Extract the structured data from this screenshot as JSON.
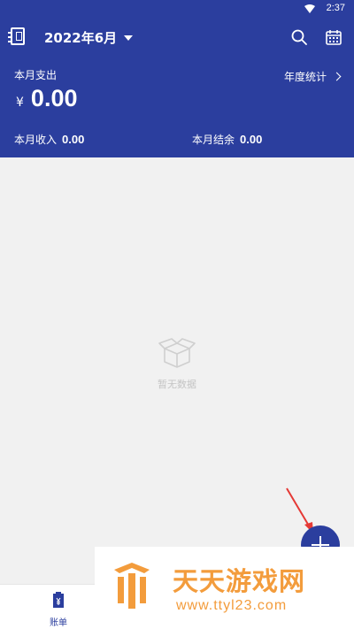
{
  "status_bar": {
    "time": "2:37"
  },
  "toolbar": {
    "month": "2022年6月"
  },
  "summary": {
    "expense_label": "本月支出",
    "yearly_stats": "年度统计",
    "currency": "¥",
    "expense_amount": "0.00",
    "income_label": "本月收入",
    "income_amount": "0.00",
    "balance_label": "本月结余",
    "balance_amount": "0.00"
  },
  "empty_state": {
    "text": "暂无数据"
  },
  "bottom_nav": {
    "bills_label": "账单"
  },
  "watermark": {
    "title": "天天游戏网",
    "url": "www.ttyl23.com"
  },
  "colors": {
    "primary": "#2b3e9e",
    "background": "#f1f1f1",
    "watermark": "#f39c3c",
    "arrow": "#e53935"
  },
  "icons": [
    "wifi-icon",
    "notebook-icon",
    "dropdown-caret-icon",
    "search-icon",
    "calendar-icon",
    "chevron-right-icon",
    "empty-box-icon",
    "plus-icon",
    "bill-icon"
  ]
}
